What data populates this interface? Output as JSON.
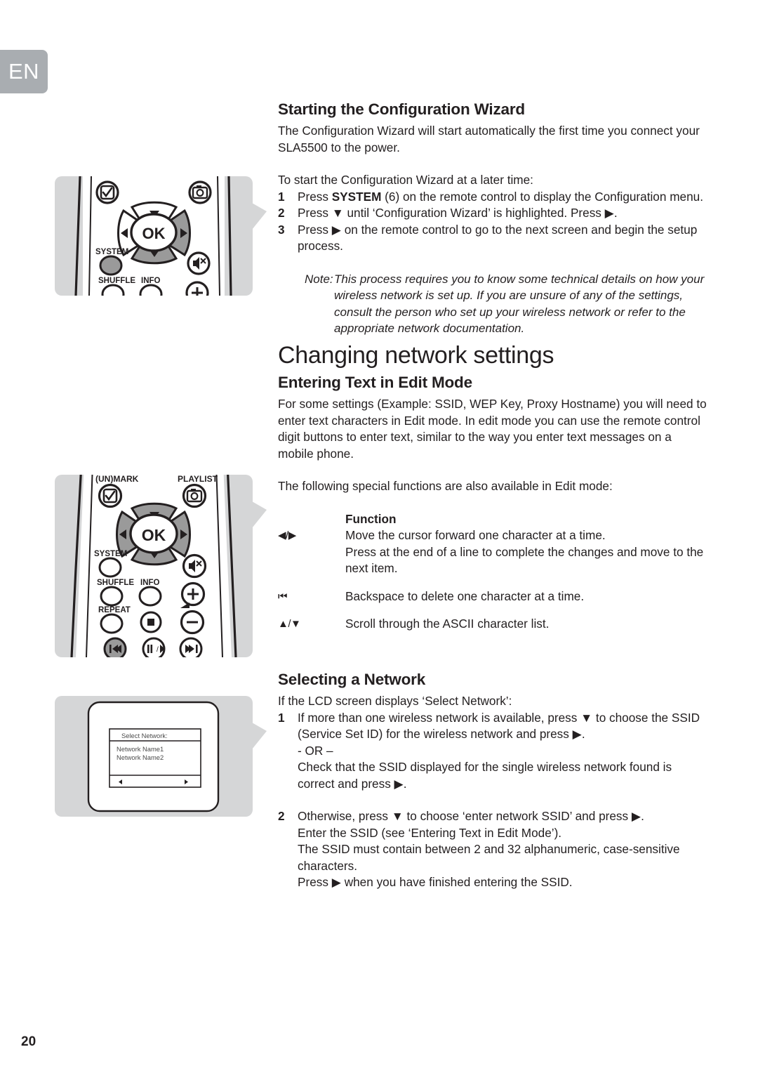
{
  "language_badge": "EN",
  "page_number": "20",
  "sections": {
    "wizard": {
      "heading": "Starting the Configuration Wizard",
      "intro": "The Configuration Wizard will start automatically the first time you connect your SLA5500 to the power.",
      "lead": "To start the Configuration Wizard at a later time:",
      "steps": [
        {
          "num": "1",
          "text_before": "Press ",
          "bold": "SYSTEM",
          "text_after": " (6) on the remote control to display the Configuration menu."
        },
        {
          "num": "2",
          "text": "Press ▼ until ‘Configuration Wizard’ is highlighted. Press ▶."
        },
        {
          "num": "3",
          "text": "Press ▶ on the remote control to go to the next screen and begin the setup process."
        }
      ],
      "note_label": "Note:",
      "note_body": "This process requires you to know some technical details on how your wireless network is set up. If you are unsure of any of the settings, consult the person who set up your wireless network or refer to the appropriate network documentation."
    },
    "changing_network": {
      "heading": "Changing network settings"
    },
    "edit_mode": {
      "heading": "Entering Text in Edit Mode",
      "intro": "For some settings (Example: SSID, WEP Key, Proxy Hostname) you will need to enter text characters in Edit mode. In edit mode you can use the remote control digit buttons to enter text, similar to the way you enter text messages on a mobile phone.",
      "lead": "The following special functions are also available in Edit mode:",
      "table_header": {
        "symbol": "",
        "function": "Function"
      },
      "rows": [
        {
          "symbol": "◀/▶",
          "lines": [
            "Move the cursor forward one character at a time.",
            "Press at the end of a line to complete the changes and move to the next item."
          ]
        },
        {
          "symbol": "⏮",
          "lines": [
            "Backspace to delete one character at a time."
          ]
        },
        {
          "symbol": "▲/▼",
          "lines": [
            "Scroll through the ASCII character list."
          ]
        }
      ]
    },
    "selecting_network": {
      "heading": "Selecting a Network",
      "lead": "If the LCD screen displays ‘Select Network’:",
      "step1": {
        "num": "1",
        "lines": [
          "If more than one wireless network is available, press ▼ to choose the SSID (Service Set ID) for the wireless network and press ▶.",
          "- OR –",
          "Check that the SSID displayed for the single wireless network found is correct and press ▶."
        ]
      },
      "step2": {
        "num": "2",
        "lines": [
          "Otherwise, press ▼ to choose ‘enter network SSID’ and press ▶.",
          "Enter the SSID (see ‘Entering Text in Edit Mode’).",
          "The SSID must contain between 2 and 32 alphanumeric, case-sensitive characters.",
          "Press ▶ when you have finished entering the SSID."
        ]
      }
    }
  },
  "illustrations": {
    "remote_top": {
      "buttons": {
        "ok": "OK",
        "system": "SYSTEM",
        "shuffle": "SHUFFLE",
        "info": "INFO"
      }
    },
    "remote_bottom": {
      "buttons": {
        "mark": "(UN)MARK",
        "playlist": "PLAYLIST",
        "ok": "OK",
        "system": "SYSTEM",
        "shuffle": "SHUFFLE",
        "info": "INFO",
        "repeat": "REPEAT"
      }
    },
    "lcd": {
      "title": "Select Network:",
      "items": [
        "Network Name1",
        "Network Name2"
      ],
      "nav_left": "◀",
      "nav_right": "▶"
    }
  },
  "colors": {
    "badge_gray": "#a9adb1",
    "callout_gray": "#d5d6d7",
    "highlight_gray": "#9a9a9a",
    "ink": "#231f20"
  }
}
